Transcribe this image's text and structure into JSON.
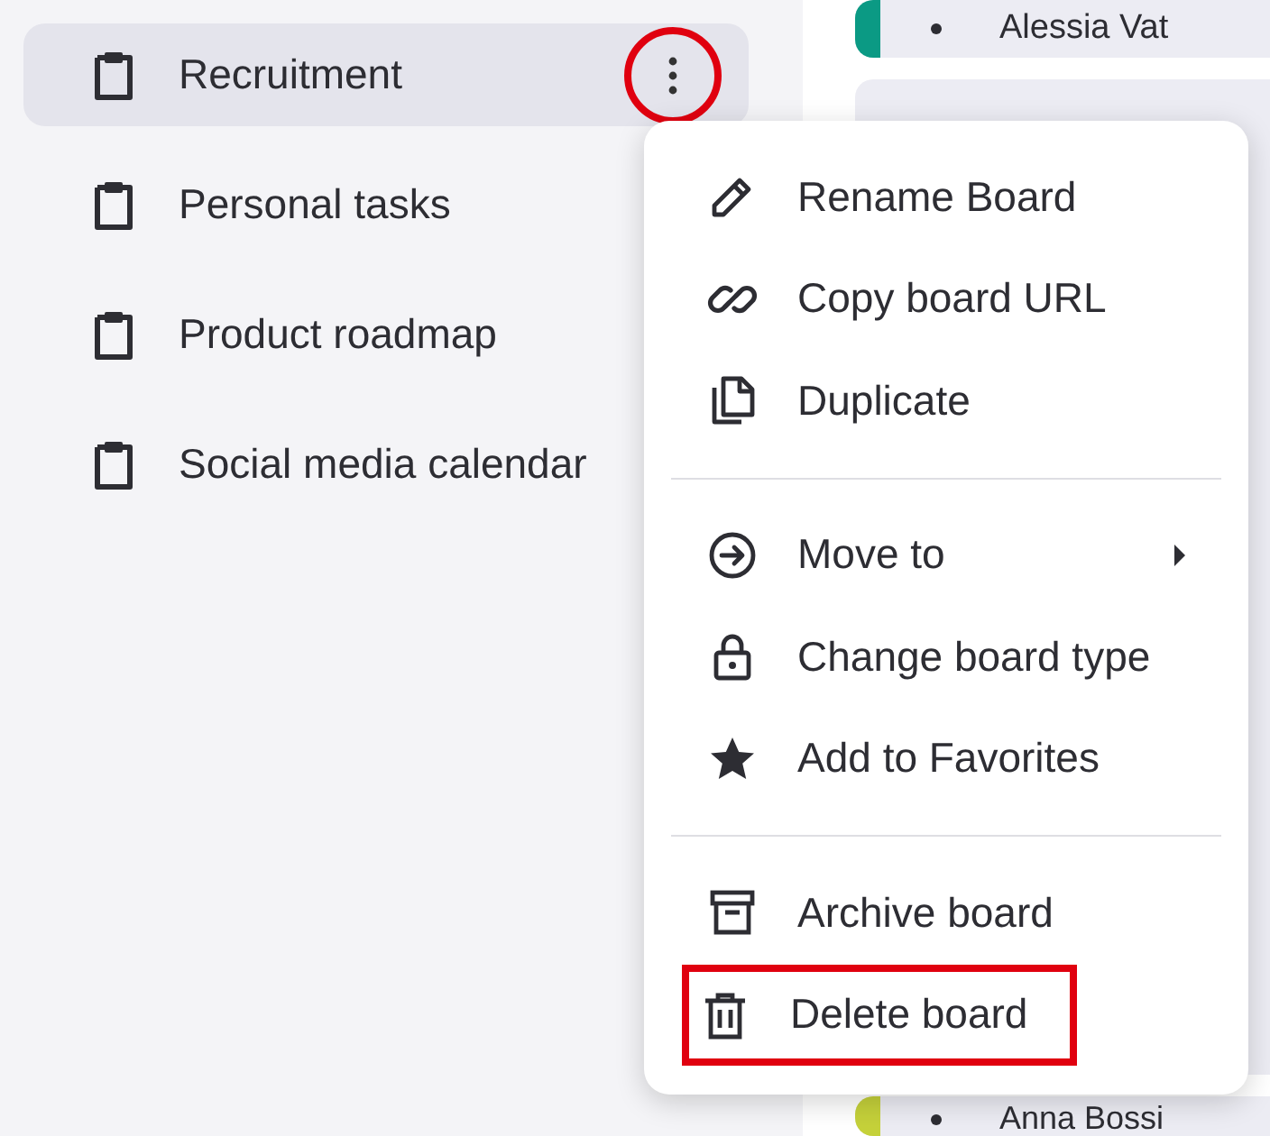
{
  "sidebar": {
    "boards": [
      {
        "label": "Recruitment",
        "selected": true
      },
      {
        "label": "Personal tasks",
        "selected": false
      },
      {
        "label": "Product roadmap",
        "selected": false
      },
      {
        "label": "Social media calendar",
        "selected": false
      }
    ],
    "options_button": {
      "highlighted": true
    }
  },
  "cards": [
    {
      "name": "Alessia Vat",
      "color": "#0b9a84"
    },
    {
      "name": "Anna Bossi",
      "color": "#c5d13a"
    }
  ],
  "board_menu": {
    "sections": [
      [
        {
          "label": "Rename Board",
          "kind": "pencil",
          "submenu": false,
          "highlighted": false
        },
        {
          "label": "Copy board URL",
          "kind": "link",
          "submenu": false,
          "highlighted": false
        },
        {
          "label": "Duplicate",
          "kind": "copy",
          "submenu": false,
          "highlighted": false
        }
      ],
      [
        {
          "label": "Move to",
          "kind": "move",
          "submenu": true,
          "highlighted": false
        },
        {
          "label": "Change board type",
          "kind": "type",
          "submenu": false,
          "highlighted": false
        },
        {
          "label": "Add to Favorites",
          "kind": "favorite",
          "submenu": false,
          "highlighted": false
        }
      ],
      [
        {
          "label": "Archive board",
          "kind": "archive",
          "submenu": false,
          "highlighted": false
        },
        {
          "label": "Delete board",
          "kind": "delete",
          "submenu": false,
          "highlighted": true
        }
      ]
    ]
  }
}
